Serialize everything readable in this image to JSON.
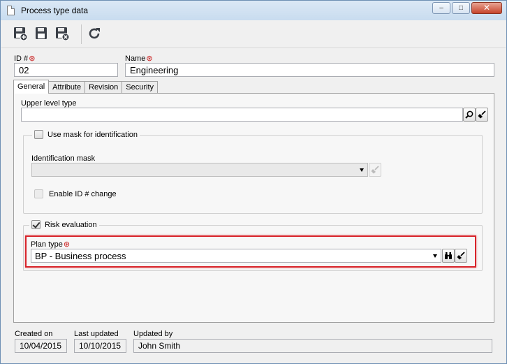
{
  "window": {
    "title": "Process type data",
    "controls": {
      "minimize": "–",
      "maximize": "□",
      "close": "✕"
    }
  },
  "toolbar": {
    "buttons": [
      "save-and-new-icon",
      "save-icon",
      "save-and-close-icon",
      "refresh-icon"
    ]
  },
  "form": {
    "id_label": "ID #",
    "id_value": "02",
    "name_label": "Name",
    "name_value": "Engineering",
    "required_mark": "⊛"
  },
  "tabs": [
    "General",
    "Attribute",
    "Revision",
    "Security"
  ],
  "general": {
    "upper_level_type_label": "Upper level type",
    "upper_level_type_value": "",
    "use_mask_label": "Use mask for identification",
    "use_mask_checked": false,
    "identification_mask_label": "Identification mask",
    "identification_mask_value": "",
    "enable_id_change_label": "Enable ID # change",
    "enable_id_change_checked": false,
    "risk_evaluation_label": "Risk evaluation",
    "risk_evaluation_checked": true,
    "plan_type_label": "Plan type",
    "plan_type_value": "BP - Business process"
  },
  "footer": {
    "created_on_label": "Created on",
    "created_on_value": "10/04/2015",
    "last_updated_label": "Last updated",
    "last_updated_value": "10/10/2015",
    "updated_by_label": "Updated by",
    "updated_by_value": "John Smith"
  },
  "colors": {
    "required": "#c81818",
    "highlight": "#d8232a"
  }
}
